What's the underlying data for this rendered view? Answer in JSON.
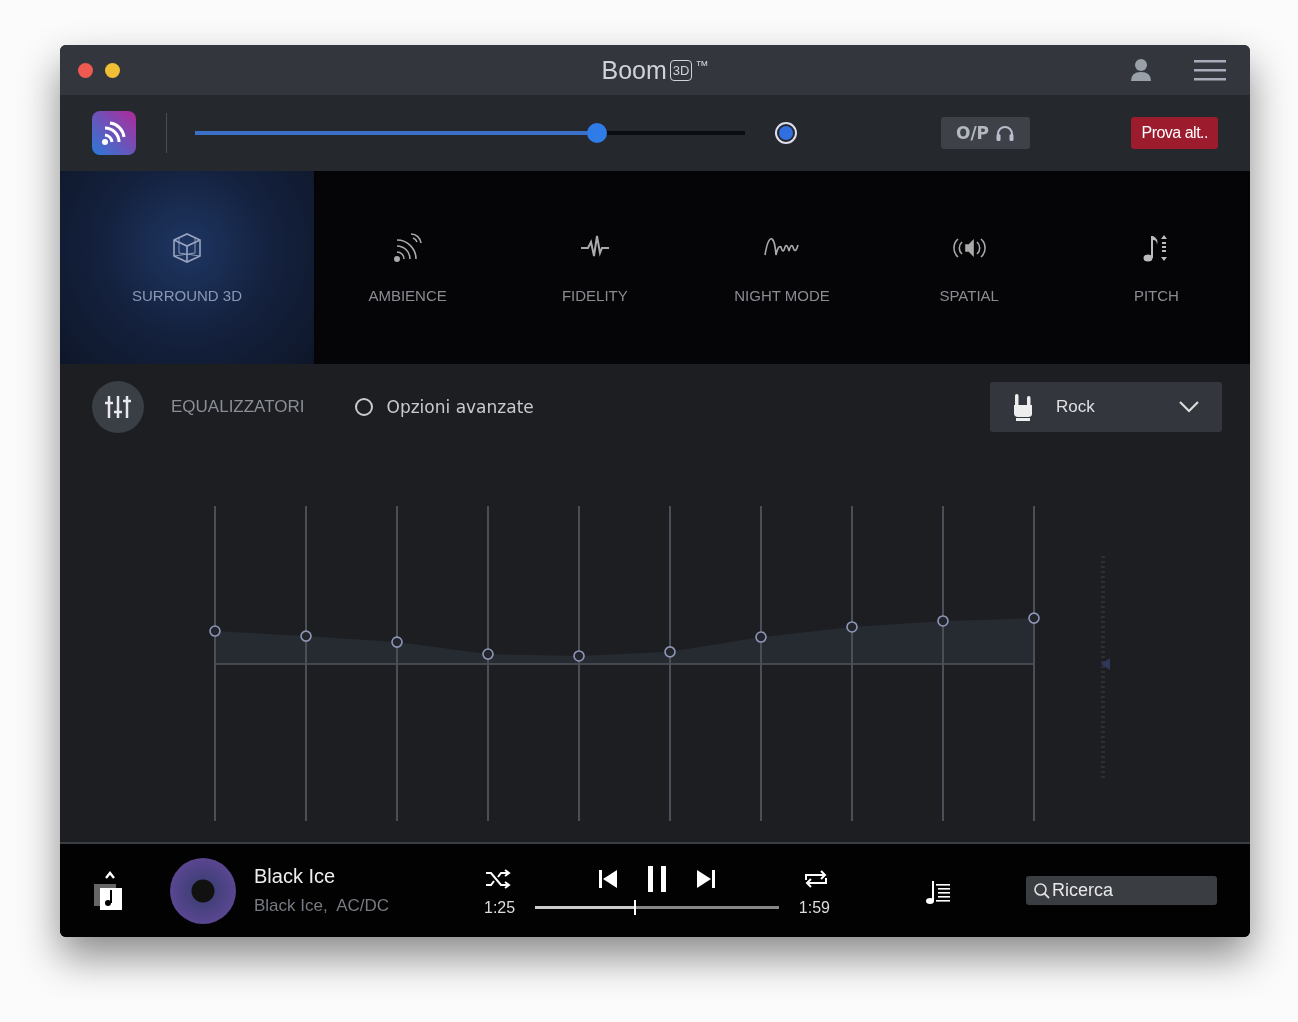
{
  "window": {
    "title": "Boom",
    "title_badge": "3D",
    "trademark": "™"
  },
  "toolbar": {
    "volume": {
      "level": 0.73
    },
    "output_button": "O/P",
    "trial_button": "Prova alt.."
  },
  "effects": [
    {
      "kind": "cube",
      "label": "SURROUND 3D",
      "selected": true
    },
    {
      "kind": "waves",
      "label": "AMBIENCE",
      "selected": false
    },
    {
      "kind": "pulse",
      "label": "FIDELITY",
      "selected": false
    },
    {
      "kind": "moon",
      "label": "NIGHT MODE",
      "selected": false
    },
    {
      "kind": "speaker",
      "label": "SPATIAL",
      "selected": false
    },
    {
      "kind": "note",
      "label": "PITCH",
      "selected": false
    }
  ],
  "equalizer": {
    "label": "EQUALIZZATORI",
    "advanced_option": {
      "label": "Opzioni avanzate",
      "checked": false
    },
    "preset": "Rock",
    "bands": [
      {
        "level": 0.603
      },
      {
        "level": 0.587
      },
      {
        "level": 0.568
      },
      {
        "level": 0.53
      },
      {
        "level": 0.524
      },
      {
        "level": 0.537
      },
      {
        "level": 0.584
      },
      {
        "level": 0.616
      },
      {
        "level": 0.635
      },
      {
        "level": 0.644
      }
    ]
  },
  "player": {
    "title": "Black Ice",
    "subtitle": "Black Ice,  AC/DC",
    "elapsed": "1:25",
    "duration": "1:59",
    "seek": {
      "level": 0.41
    },
    "search": {
      "placeholder": "Ricerca"
    }
  }
}
